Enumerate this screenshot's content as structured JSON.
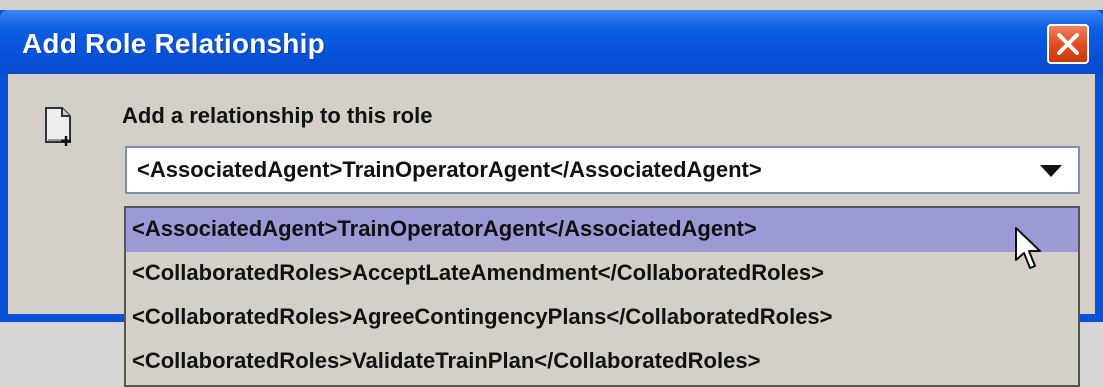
{
  "window": {
    "title": "Add Role Relationship",
    "close_icon": "close-icon"
  },
  "content": {
    "icon": "new-document-icon",
    "prompt": "Add a relationship to this role",
    "combo": {
      "selected_value": "<AssociatedAgent>TrainOperatorAgent</AssociatedAgent>",
      "arrow_icon": "chevron-down-icon"
    }
  },
  "dropdown": {
    "options": [
      "<AssociatedAgent>TrainOperatorAgent</AssociatedAgent>",
      "<CollaboratedRoles>AcceptLateAmendment</CollaboratedRoles>",
      "<CollaboratedRoles>AgreeContingencyPlans</CollaboratedRoles>",
      "<CollaboratedRoles>ValidateTrainPlan</CollaboratedRoles>"
    ],
    "selected_index": 0
  },
  "colors": {
    "titlebar": "#0650d8",
    "close_button": "#e04a1e",
    "highlight": "#9c9ad6",
    "dialog_bg": "#d4d0c8"
  }
}
